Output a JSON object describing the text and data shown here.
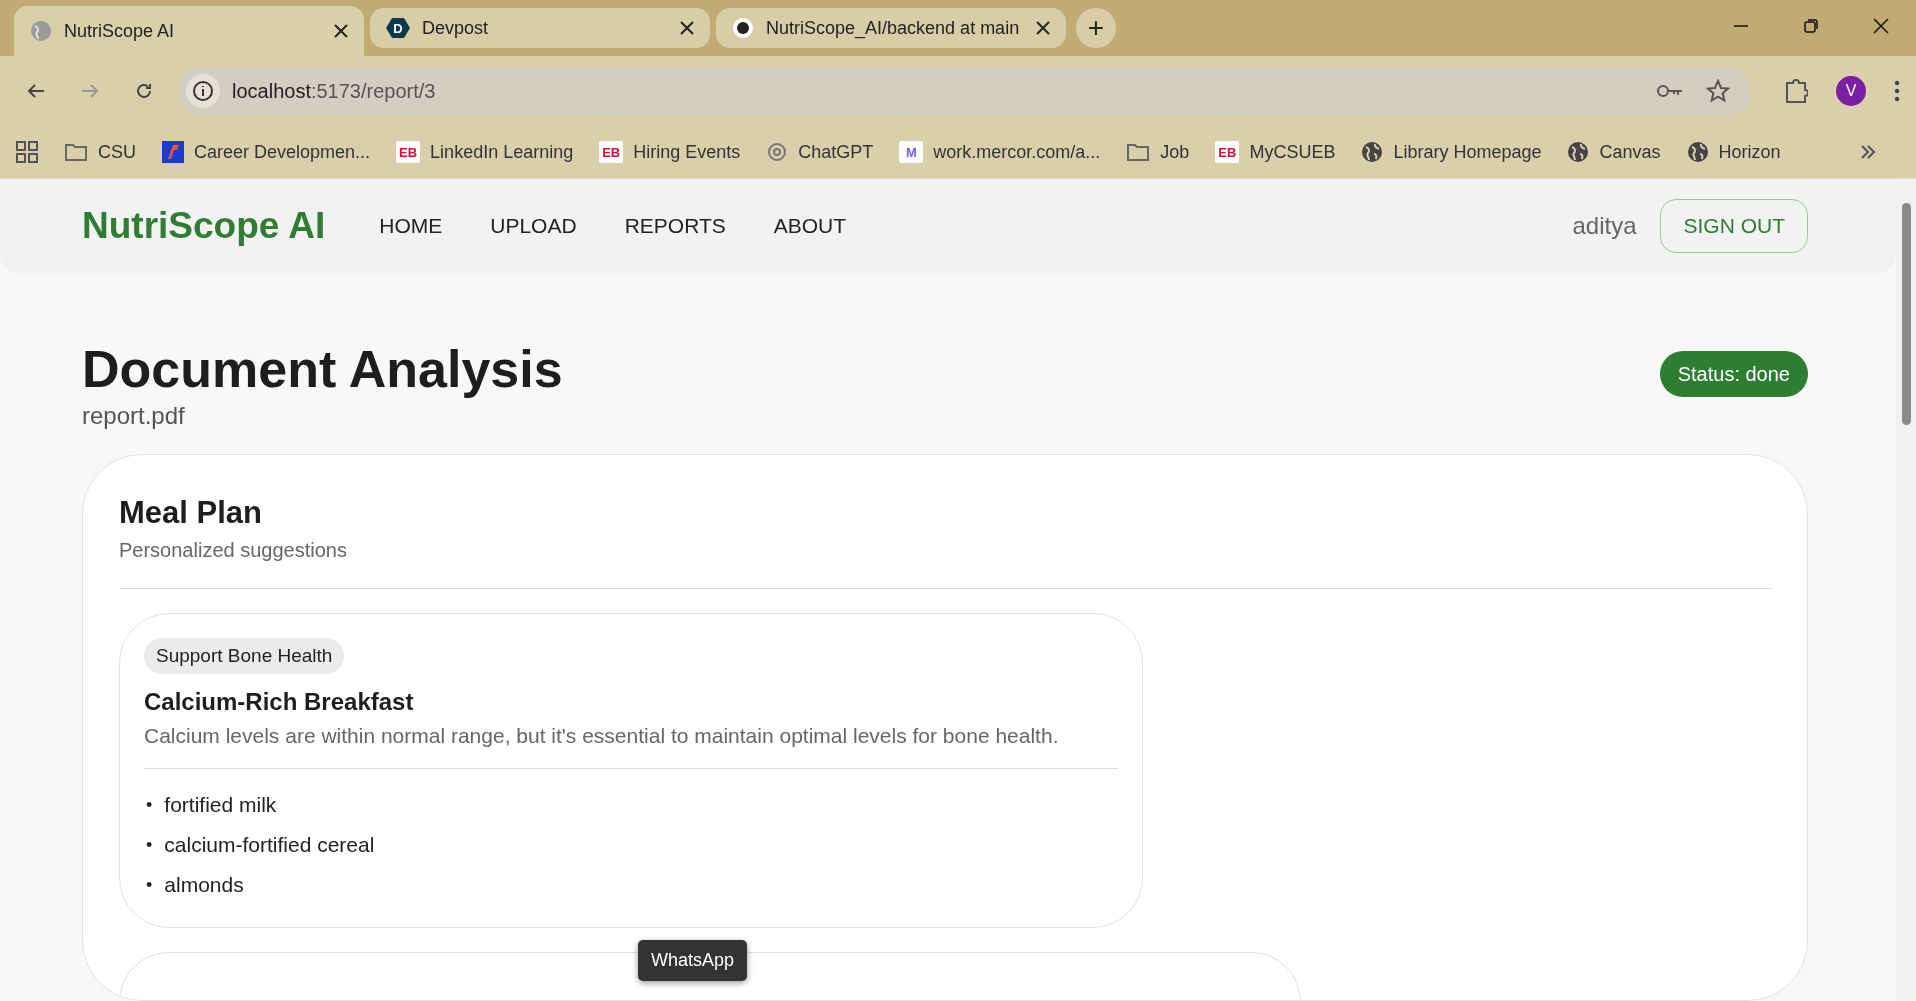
{
  "browser": {
    "tabs": [
      {
        "title": "NutriScope AI",
        "kind": "globe",
        "selected": true
      },
      {
        "title": "Devpost",
        "kind": "hex",
        "icon_text": "D",
        "selected": false
      },
      {
        "title": "NutriScope_AI/backend at main",
        "kind": "github",
        "selected": false
      }
    ],
    "new_tab": "+",
    "address": {
      "host": "localhost",
      "path": ":5173/report/3"
    },
    "profile": "V",
    "bookmarks": [
      {
        "label": "CSU",
        "kind": "folder"
      },
      {
        "label": "Career Developmen...",
        "kind": "career"
      },
      {
        "label": "LinkedIn Learning",
        "kind": "eb",
        "icon_text": "EB"
      },
      {
        "label": "Hiring Events",
        "kind": "eb",
        "icon_text": "EB"
      },
      {
        "label": "ChatGPT",
        "kind": "chatgpt"
      },
      {
        "label": "work.mercor.com/a...",
        "kind": "mercor",
        "icon_text": "M"
      },
      {
        "label": "Job",
        "kind": "folder"
      },
      {
        "label": "MyCSUEB",
        "kind": "eb",
        "icon_text": "EB"
      },
      {
        "label": "Library Homepage",
        "kind": "globe"
      },
      {
        "label": "Canvas",
        "kind": "globe"
      },
      {
        "label": "Horizon",
        "kind": "globe"
      }
    ]
  },
  "navbar": {
    "logo": "NutriScope AI",
    "links": [
      "HOME",
      "UPLOAD",
      "REPORTS",
      "ABOUT"
    ],
    "user": "aditya",
    "sign_out": "SIGN OUT"
  },
  "page": {
    "title": "Document Analysis",
    "filename": "report.pdf",
    "status": "Status: done"
  },
  "meal_plan": {
    "title": "Meal Plan",
    "subtitle": "Personalized suggestions",
    "meals": [
      {
        "bullet": "•",
        "tag": "Support Bone Health",
        "title": "Calcium-Rich Breakfast",
        "description": "Calcium levels are within normal range, but it's essential to maintain optimal levels for bone health.",
        "items": [
          "fortified milk",
          "calcium-fortified cereal",
          "almonds"
        ]
      }
    ]
  },
  "tooltip": "WhatsApp"
}
